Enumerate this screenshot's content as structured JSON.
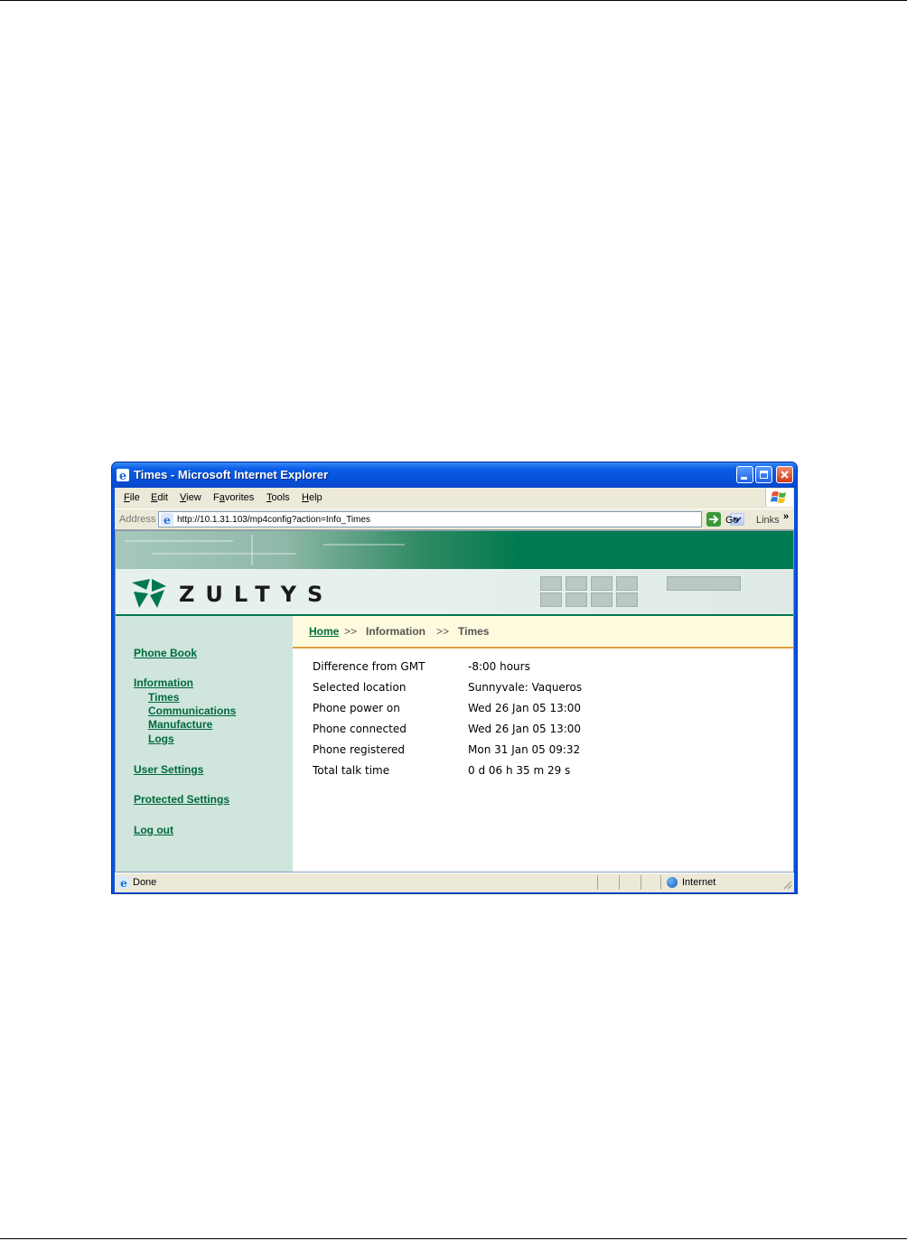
{
  "window": {
    "title": "Times - Microsoft Internet Explorer"
  },
  "menu": {
    "items": [
      {
        "label": "File",
        "accel": "F",
        "rest": "ile"
      },
      {
        "label": "Edit",
        "accel": "E",
        "rest": "dit"
      },
      {
        "label": "View",
        "accel": "V",
        "rest": "iew"
      },
      {
        "label": "Favorites",
        "accel": "a",
        "prefix": "F",
        "rest": "vorites"
      },
      {
        "label": "Tools",
        "accel": "T",
        "rest": "ools"
      },
      {
        "label": "Help",
        "accel": "H",
        "rest": "elp"
      }
    ]
  },
  "address": {
    "label": "Address",
    "url": "http://10.1.31.103/mp4config?action=Info_Times",
    "go": "Go",
    "links": "Links",
    "links_chevron": "»"
  },
  "brand": {
    "name": "ZULTYS",
    "accent": "#00784d"
  },
  "nav": {
    "phone_book": "Phone Book",
    "information": "Information",
    "times": "Times",
    "communications": "Communications",
    "manufacture": "Manufacture",
    "logs": "Logs",
    "user_settings": "User Settings",
    "protected_settings": "Protected Settings",
    "log_out": "Log out"
  },
  "breadcrumb": {
    "home": "Home",
    "sep1": ">>",
    "information": "Information",
    "sep2": ">>",
    "times": "Times"
  },
  "info": [
    {
      "label": "Difference from GMT",
      "value": "-8:00 hours"
    },
    {
      "label": "Selected location",
      "value": "Sunnyvale: Vaqueros"
    },
    {
      "label": "Phone power on",
      "value": "Wed 26 Jan 05 13:00"
    },
    {
      "label": "Phone connected",
      "value": "Wed 26 Jan 05 13:00"
    },
    {
      "label": "Phone registered",
      "value": "Mon 31 Jan 05 09:32"
    },
    {
      "label": "Total talk time",
      "value": "0 d 06 h 35 m 29 s"
    }
  ],
  "status": {
    "text": "Done",
    "zone": "Internet"
  }
}
